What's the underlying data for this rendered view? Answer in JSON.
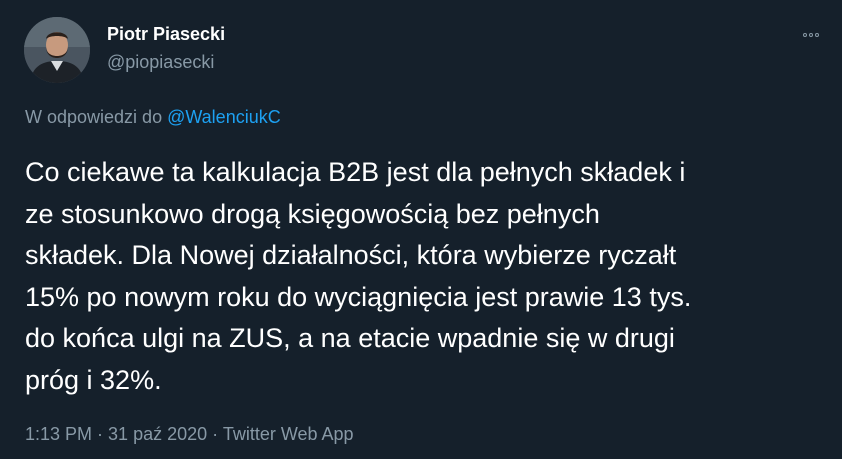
{
  "author": {
    "name": "Piotr Piasecki",
    "handle": "@piopiasecki",
    "avatar": "avatar"
  },
  "more_icon": "more-options-icon",
  "reply": {
    "prefix": "W odpowiedzi do ",
    "mention": "@WalenciukC"
  },
  "tweet": {
    "text": "Co ciekawe ta kalkulacja B2B jest dla pełnych składek i\nze stosunkowo drogą księgowością bez pełnych\nskładek. Dla Nowej działalności, która wybierze ryczałt\n15% po nowym roku do wyciągnięcia jest prawie 13 tys.\ndo końca ulgi na ZUS, a na etacie wpadnie się w drugi\npróg i 32%."
  },
  "meta": {
    "time": "1:13 PM",
    "separator1": " · ",
    "date": "31 paź 2020",
    "separator2": " · ",
    "source": "Twitter Web App"
  },
  "colors": {
    "background": "#15202b",
    "text": "#ffffff",
    "secondary": "#8899a6",
    "accent": "#1da1f2"
  }
}
